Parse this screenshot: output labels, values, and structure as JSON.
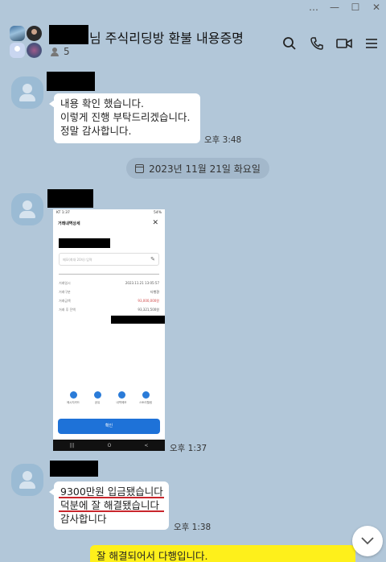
{
  "window": {
    "controls": [
      "…",
      "—",
      "☐",
      "✕"
    ]
  },
  "header": {
    "title": "님 주식리딩방 환불 내용증명",
    "member_count": "5"
  },
  "messages": {
    "first": {
      "lines": [
        "내용 확인 했습니다.",
        "이렇게 진행 부탁드리겠습니다.",
        "정말 감사합니다."
      ],
      "time": "오후 3:48"
    },
    "date_divider": "2023년 11월 21일 화요일",
    "image_msg": {
      "time": "오후 1:37",
      "screenshot": {
        "status_left": "KT 1:37",
        "status_right": "54%",
        "title": "거래내역상세",
        "close": "✕",
        "memo_placeholder": "메모(최대 20자) 입력",
        "rows": [
          {
            "label": "거래일시",
            "value": "2023.11.21 13:05:57"
          },
          {
            "label": "거래구분",
            "value": "타행환"
          },
          {
            "label": "거래금액",
            "value": "93,000,000원"
          },
          {
            "label": "거래 후 잔액",
            "value": "93,321,500원"
          }
        ],
        "quick_actions": [
          "메시지카드",
          "공유",
          "내역메모",
          "스토리텔링"
        ],
        "confirm": "확인",
        "nav": [
          "|||",
          "O",
          "<"
        ]
      }
    },
    "third": {
      "lines": [
        "9300만원 입금됐습니다",
        "덕분에 잘 해결됐습니다",
        "감사합니다"
      ],
      "time": "오후 1:38"
    },
    "mine": {
      "text": "잘 해결되어서 다행입니다."
    }
  },
  "colors": {
    "background": "#b2c7d9",
    "my_bubble": "#fef01b",
    "underline": "#c8262c",
    "confirm_button": "#1e72d8"
  }
}
